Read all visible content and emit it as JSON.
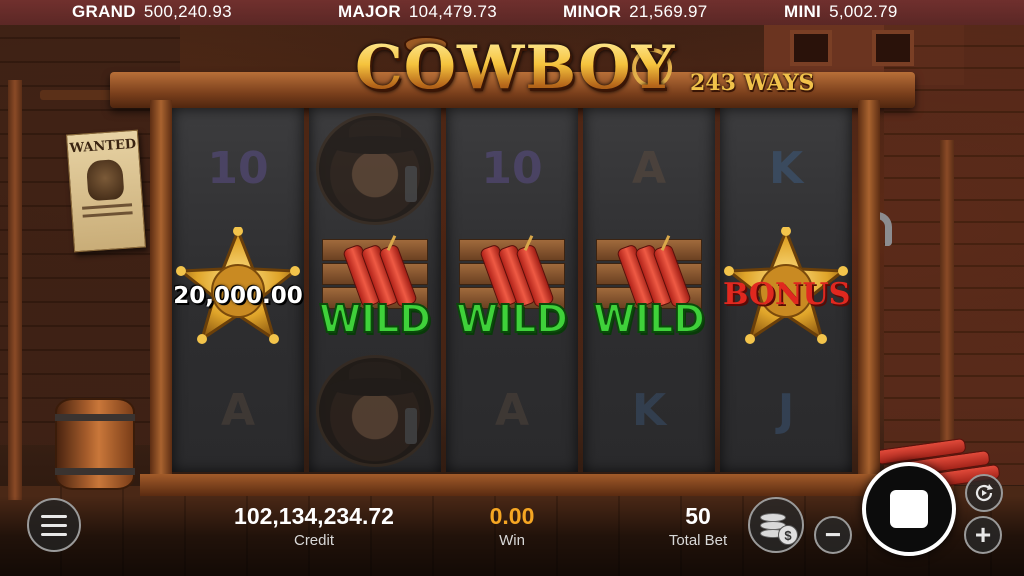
{
  "jackpots": [
    {
      "label": "GRAND",
      "value": "500,240.93"
    },
    {
      "label": "MAJOR",
      "value": "104,479.73"
    },
    {
      "label": "MINOR",
      "value": "21,569.97"
    },
    {
      "label": "MINI",
      "value": "5,002.79"
    }
  ],
  "logo": {
    "title": "COWBOY",
    "ways": "243 WAYS"
  },
  "poster": {
    "title": "WANTED"
  },
  "reels": [
    [
      "10",
      "sheriff-star-win",
      "A"
    ],
    [
      "cowboy",
      "wild",
      "cowboy"
    ],
    [
      "10",
      "wild",
      "A"
    ],
    [
      "A",
      "wild",
      "K"
    ],
    [
      "K",
      "bonus",
      "J"
    ]
  ],
  "symbols": {
    "wild_label": "WILD",
    "bonus_label": "BONUS",
    "star_win_amount": "20,000.00"
  },
  "hud": {
    "credit_value": "102,134,234.72",
    "credit_label": "Credit",
    "win_value": "0.00",
    "win_label": "Win",
    "bet_value": "50",
    "bet_label": "Total Bet"
  },
  "buttons": {
    "minus": "−",
    "plus": "+",
    "coin_symbol": "$"
  },
  "colors": {
    "win_value": "#f5a623",
    "wild_text": "#3fd13a",
    "bonus_text": "#e0281f",
    "logo_gold": "#f3c44b",
    "jackpot_bar": "#6b2c2c"
  }
}
